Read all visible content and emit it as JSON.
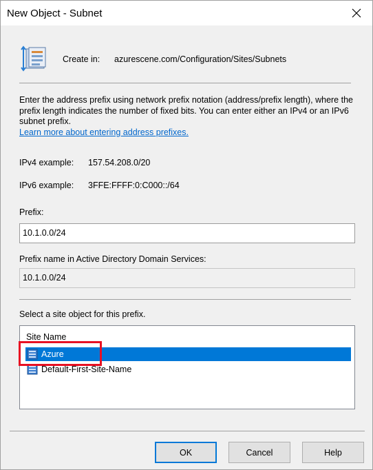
{
  "window": {
    "title": "New Object - Subnet",
    "close_glyph": "✕"
  },
  "header": {
    "create_in_label": "Create in:",
    "create_in_path": "azurescene.com/Configuration/Sites/Subnets",
    "icon": "subnet-object-icon"
  },
  "description": {
    "text": "Enter the address prefix using network prefix notation (address/prefix length), where the prefix length indicates the number of fixed bits. You can enter either an IPv4 or an IPv6 subnet prefix.",
    "link": "Learn more about entering address prefixes."
  },
  "examples": {
    "ipv4_label": "IPv4 example:",
    "ipv4_value": "157.54.208.0/20",
    "ipv6_label": "IPv6 example:",
    "ipv6_value": "3FFE:FFFF:0:C000::/64"
  },
  "prefix": {
    "label": "Prefix:",
    "value": "10.1.0.0/24"
  },
  "prefix_name": {
    "label": "Prefix name in Active Directory Domain Services:",
    "value": "10.1.0.0/24"
  },
  "site_list": {
    "label": "Select a site object for this prefix.",
    "column_header": "Site Name",
    "items": [
      {
        "name": "Azure",
        "selected": true
      },
      {
        "name": "Default-First-Site-Name",
        "selected": false
      }
    ]
  },
  "buttons": {
    "ok": "OK",
    "cancel": "Cancel",
    "help": "Help"
  },
  "colors": {
    "selection": "#0078d7",
    "annotation": "#e81123",
    "link": "#0066cc"
  }
}
